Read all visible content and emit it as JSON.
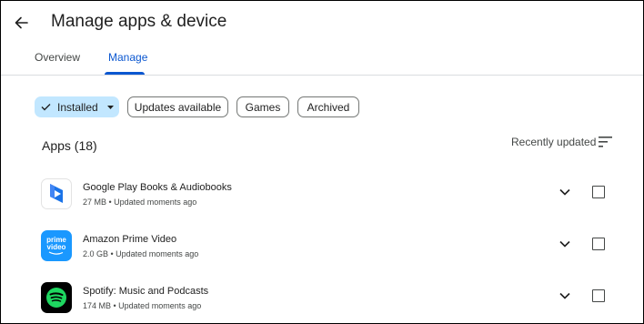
{
  "header": {
    "title": "Manage apps & device",
    "back_icon": "arrow-back-icon"
  },
  "tabs": [
    {
      "label": "Overview",
      "active": false
    },
    {
      "label": "Manage",
      "active": true
    }
  ],
  "filters": [
    {
      "label": "Installed",
      "selected": true,
      "icon": "check-icon",
      "dropdown_icon": "caret-down-icon"
    },
    {
      "label": "Updates available",
      "selected": false
    },
    {
      "label": "Games",
      "selected": false
    },
    {
      "label": "Archived",
      "selected": false
    }
  ],
  "list": {
    "title": "Apps (18)",
    "sort_label": "Recently updated",
    "sort_icon": "sort-icon"
  },
  "apps": [
    {
      "name": "Google Play Books & Audiobooks",
      "meta": "27 MB • Updated moments ago",
      "icon": "play-books-icon",
      "checked": false
    },
    {
      "name": "Amazon Prime Video",
      "meta": "2.0 GB • Updated moments ago",
      "icon": "prime-video-icon",
      "icon_text_1": "prime",
      "icon_text_2": "video",
      "checked": false
    },
    {
      "name": "Spotify: Music and Podcasts",
      "meta": "174 MB • Updated moments ago",
      "icon": "spotify-icon",
      "checked": false
    }
  ],
  "colors": {
    "accent": "#0b57d0",
    "chip_selected": "#c2e7ff",
    "prime": "#1a98ff",
    "spotify_green": "#1ed760"
  }
}
